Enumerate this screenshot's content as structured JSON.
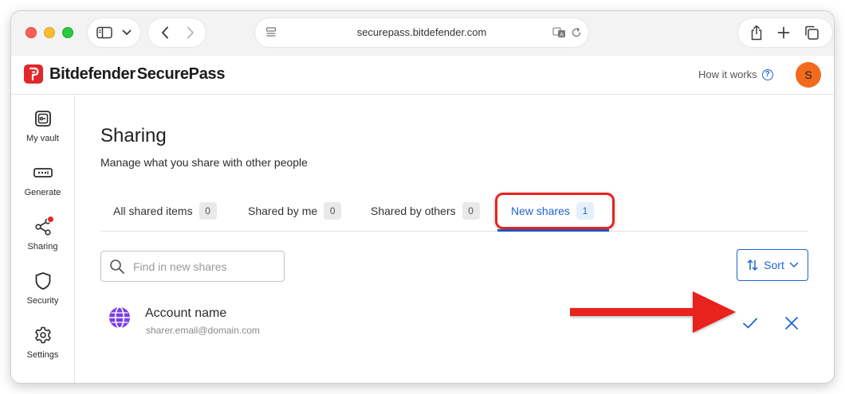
{
  "browser": {
    "url": "securepass.bitdefender.com"
  },
  "header": {
    "brand_name": "Bitdefender",
    "brand_product": "SecurePass",
    "how_it_works": "How it works",
    "help_glyph": "?",
    "avatar_initial": "S"
  },
  "sidebar": {
    "items": [
      {
        "label": "My vault",
        "icon": "vault-icon"
      },
      {
        "label": "Generate",
        "icon": "password-generator-icon"
      },
      {
        "label": "Sharing",
        "icon": "share-icon"
      },
      {
        "label": "Security",
        "icon": "shield-icon"
      },
      {
        "label": "Settings",
        "icon": "gear-icon"
      }
    ]
  },
  "main": {
    "title": "Sharing",
    "subtitle": "Manage what you share with other people",
    "tabs": [
      {
        "label": "All shared items",
        "count": "0"
      },
      {
        "label": "Shared by me",
        "count": "0"
      },
      {
        "label": "Shared by others",
        "count": "0"
      },
      {
        "label": "New shares",
        "count": "1"
      }
    ],
    "active_tab": "New shares",
    "search": {
      "placeholder": "Find in new shares",
      "value": ""
    },
    "sort_label": "Sort",
    "shares": [
      {
        "name": "Account name",
        "email": "sharer.email@domain.com",
        "icon": "globe-icon"
      }
    ]
  },
  "colors": {
    "accent": "#1e63d6",
    "brand_red": "#e2272b",
    "avatar": "#f26b1d",
    "annotation_red": "#e8231f",
    "globe_purple": "#7b3fe4"
  }
}
